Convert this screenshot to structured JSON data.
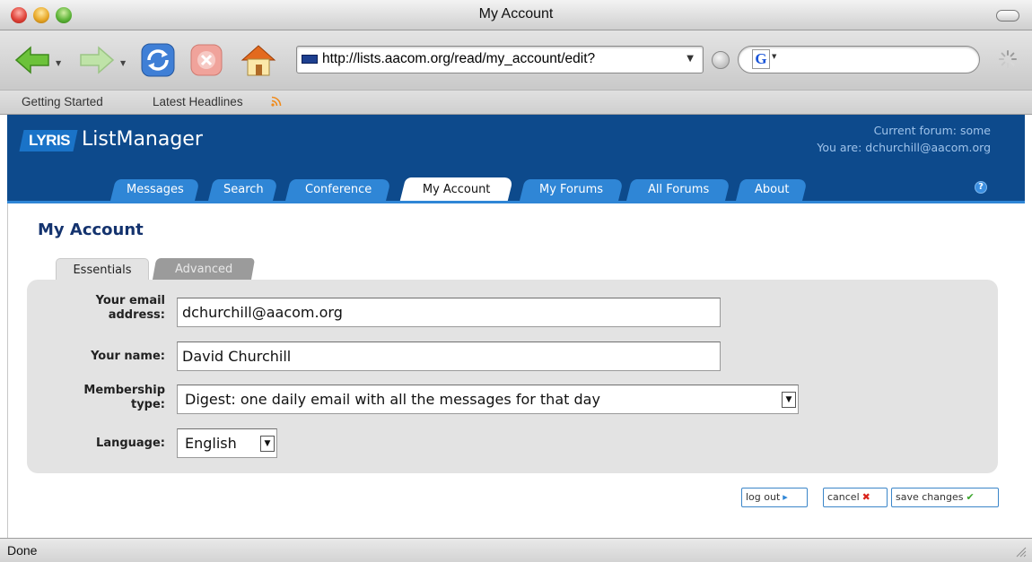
{
  "window": {
    "title": "My Account"
  },
  "browser": {
    "url": "http://lists.aacom.org/read/my_account/edit?",
    "search_engine_letter": "G",
    "bookmarks": [
      "Getting Started",
      "Latest Headlines"
    ],
    "status": "Done"
  },
  "app": {
    "brand_badge": "LYRIS",
    "brand_name": "ListManager",
    "current_forum_line": "Current forum: some",
    "you_are_line": "You are: dchurchill@aacom.org",
    "help_label": "?",
    "tabs": [
      "Messages",
      "Search",
      "Conference",
      "My Account",
      "My Forums",
      "All Forums",
      "About"
    ],
    "active_tab": "My Account"
  },
  "page": {
    "title": "My Account",
    "subtabs": [
      "Essentials",
      "Advanced"
    ],
    "active_subtab": "Essentials"
  },
  "form": {
    "email_label_line1": "Your email",
    "email_label_line2": "address:",
    "email_value": "dchurchill@aacom.org",
    "name_label": "Your name:",
    "name_value": "David Churchill",
    "membership_label_line1": "Membership",
    "membership_label_line2": "type:",
    "membership_value": "Digest: one daily email with all the messages for that day",
    "language_label": "Language:",
    "language_value": "English"
  },
  "actions": {
    "logout": "log out",
    "cancel": "cancel",
    "save": "save changes"
  },
  "colors": {
    "header_bg": "#0d4a8c",
    "tab_bg": "#2f86d6",
    "title_color": "#14336e",
    "panel_bg": "#e3e3e3"
  }
}
